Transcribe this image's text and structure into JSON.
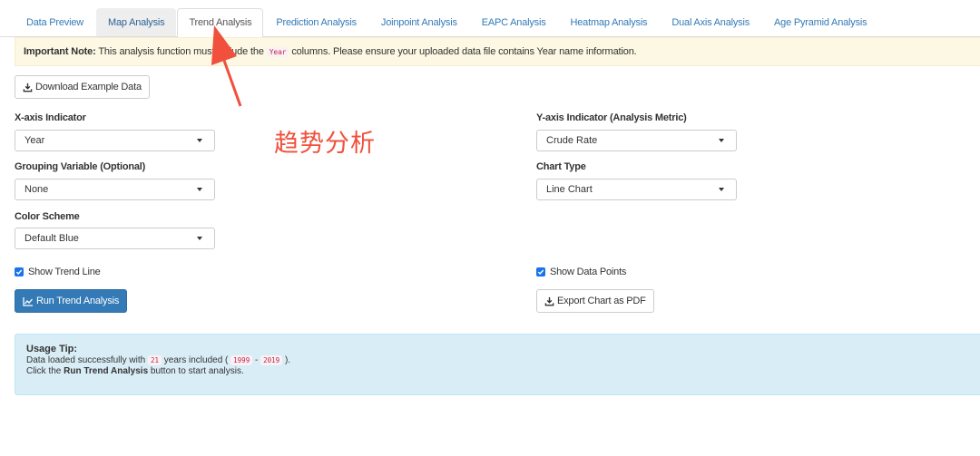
{
  "tabs": [
    {
      "label": "Data Preview"
    },
    {
      "label": "Map Analysis"
    },
    {
      "label": "Trend Analysis"
    },
    {
      "label": "Prediction Analysis"
    },
    {
      "label": "Joinpoint Analysis"
    },
    {
      "label": "EAPC Analysis"
    },
    {
      "label": "Heatmap Analysis"
    },
    {
      "label": "Dual Axis Analysis"
    },
    {
      "label": "Age Pyramid Analysis"
    }
  ],
  "active_tab": "Trend Analysis",
  "notice": {
    "strong": "Important Note:",
    "text_before": "This analysis function must include the",
    "code": "Year",
    "text_after": "columns. Please ensure your uploaded data file contains Year name information."
  },
  "download_example_label": "Download Example Data",
  "annotation_text": "趋势分析",
  "form": {
    "x_axis": {
      "label": "X-axis Indicator",
      "value": "Year"
    },
    "grouping": {
      "label": "Grouping Variable (Optional)",
      "value": "None"
    },
    "color_scheme": {
      "label": "Color Scheme",
      "value": "Default Blue"
    },
    "y_axis": {
      "label": "Y-axis Indicator (Analysis Metric)",
      "value": "Crude Rate"
    },
    "chart_type": {
      "label": "Chart Type",
      "value": "Line Chart"
    },
    "show_trend_line": {
      "label": "Show Trend Line",
      "checked": true
    },
    "show_data_points": {
      "label": "Show Data Points",
      "checked": true
    }
  },
  "run_button_label": "Run Trend Analysis",
  "export_button_label": "Export Chart as PDF",
  "tip": {
    "title": "Usage Tip:",
    "line1_before": "Data loaded successfully with",
    "years_count": "21",
    "line1_mid": "years included (",
    "year_start": "1999",
    "dash": "-",
    "year_end": "2019",
    "line1_after": ").",
    "line2_before": "Click the",
    "line2_strong": "Run Trend Analysis",
    "line2_after": "button to start analysis."
  },
  "colors": {
    "primary": "#337ab7",
    "notice_bg": "#fcf8e3",
    "tip_bg": "#d9edf7",
    "annotation": "#f0503c",
    "code": "#c7254e"
  }
}
